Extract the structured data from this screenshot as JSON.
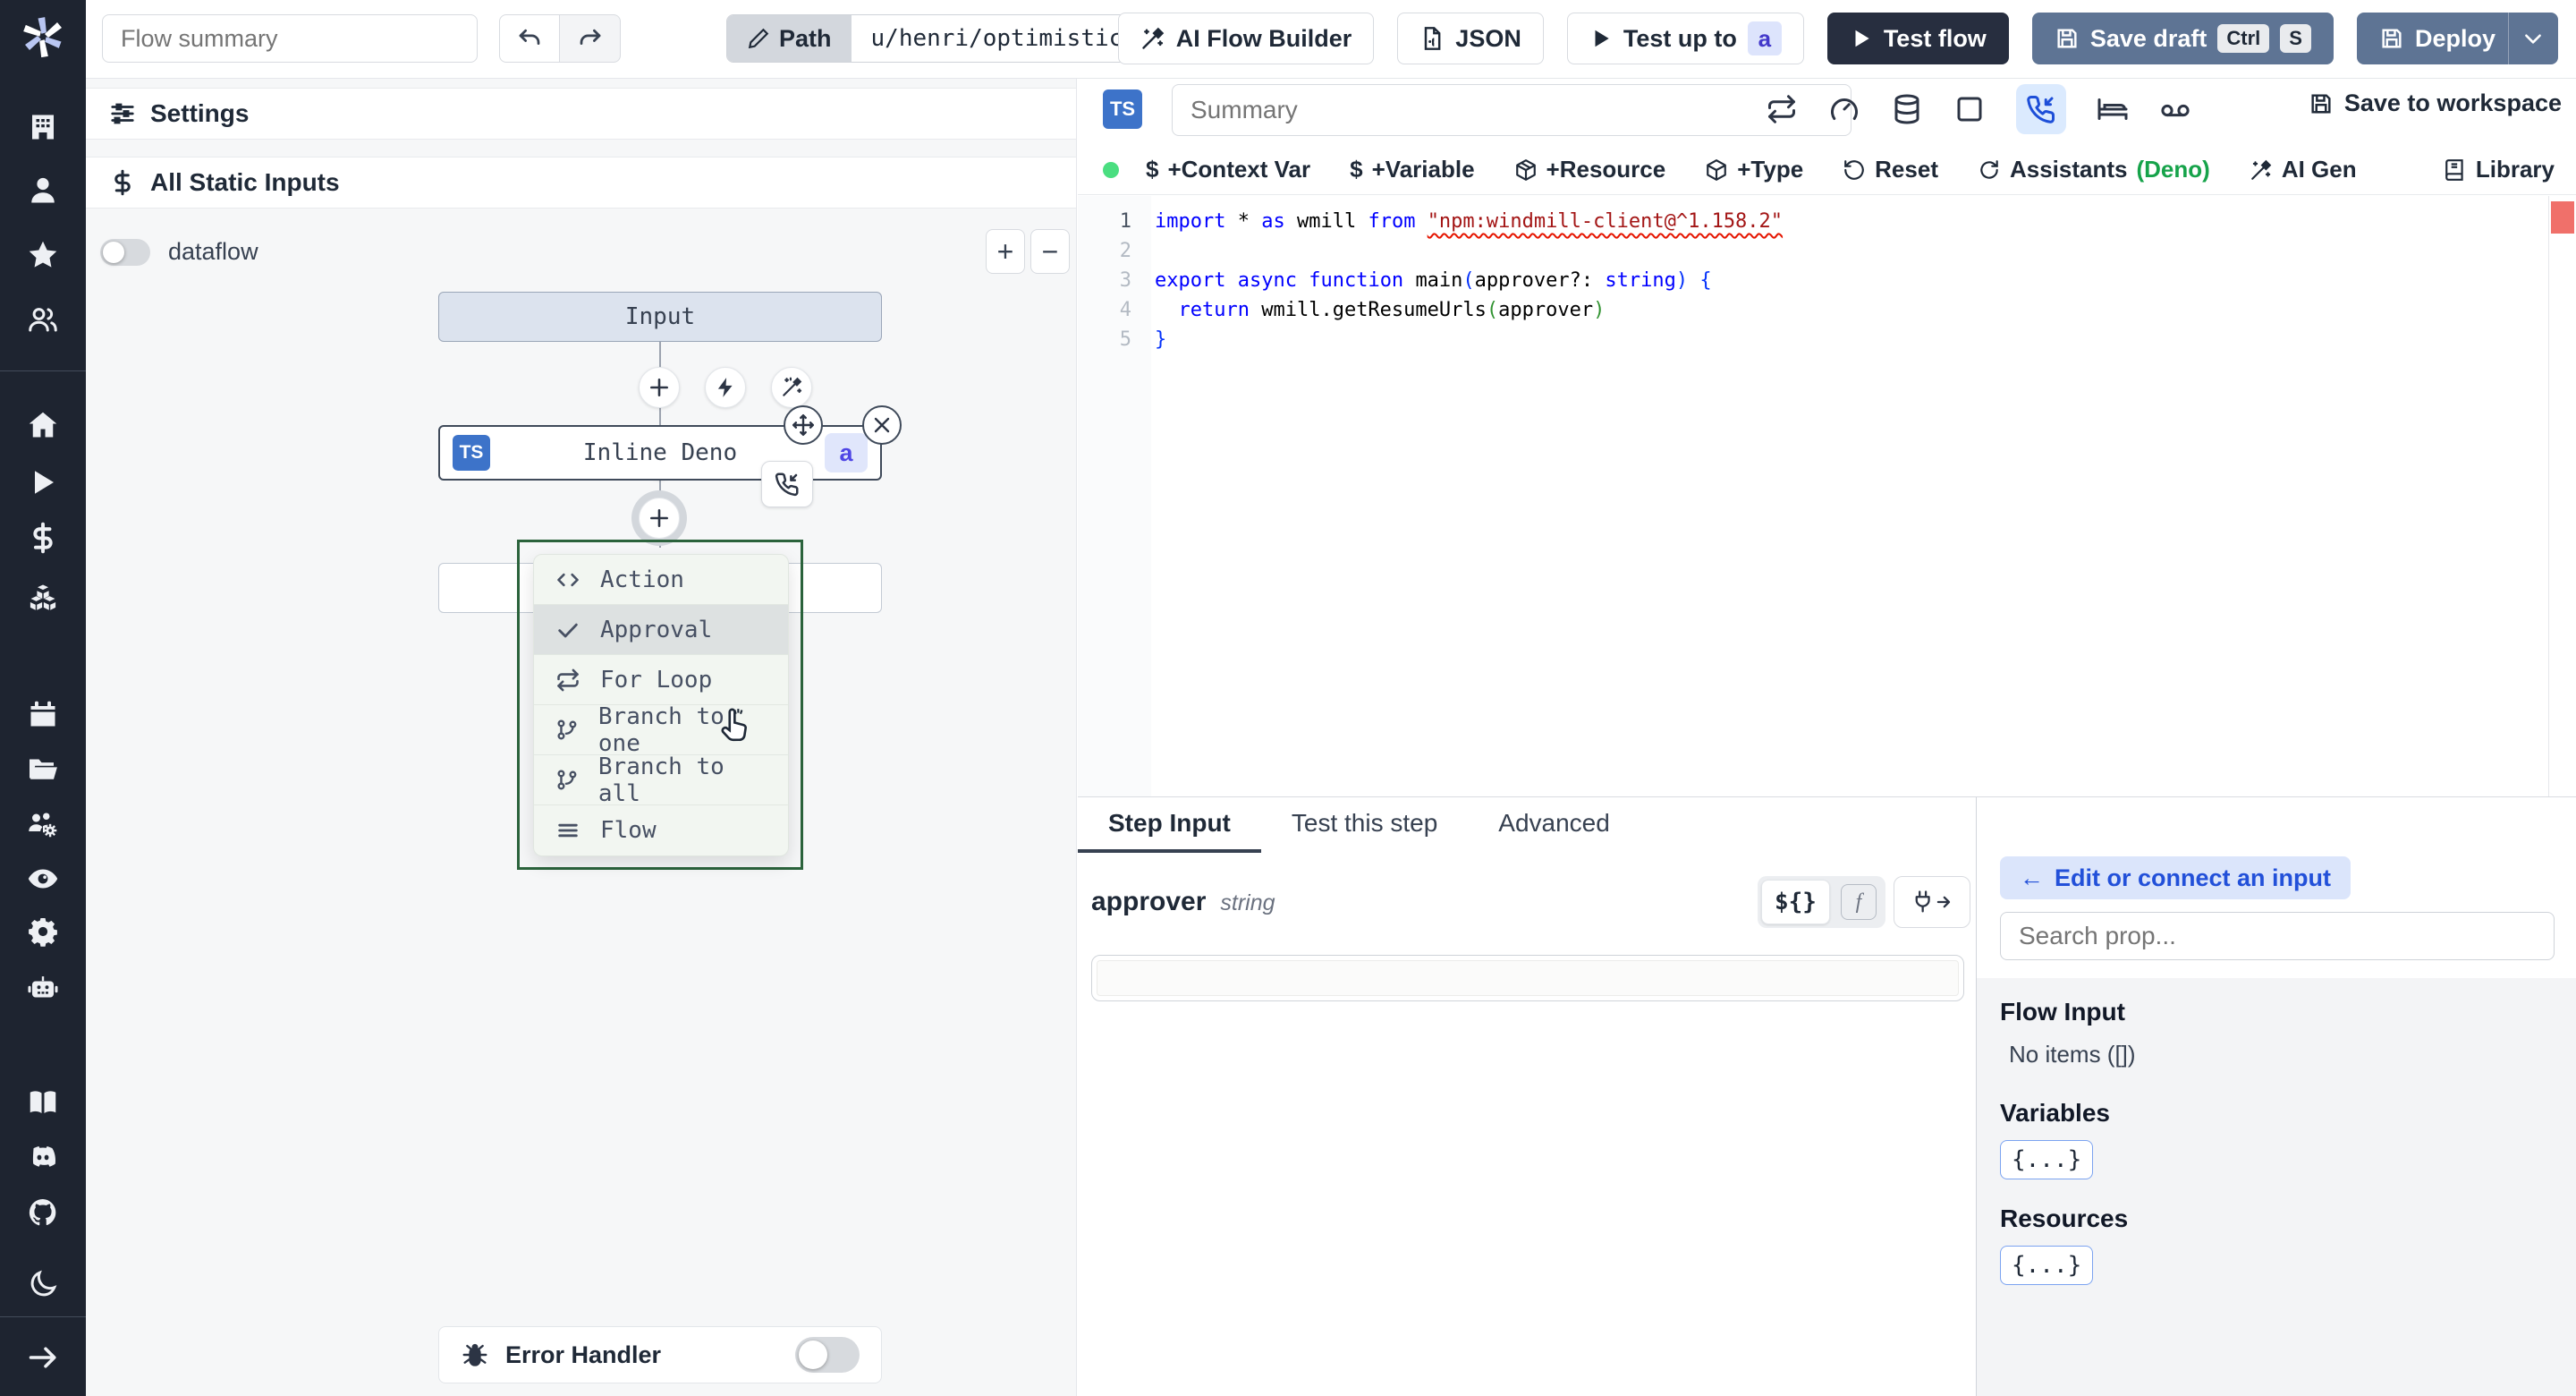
{
  "colors": {
    "accent_blue": "#2563eb",
    "sidebar_bg": "#1e2430",
    "button_slate": "#5e7494",
    "button_dark": "#272e3f",
    "menu_green_border": "#2b633c",
    "status_green": "#4ade80",
    "error_red": "#f0706a"
  },
  "sidebar": {
    "icons": [
      "building",
      "user",
      "star",
      "users-group",
      "home",
      "play",
      "dollar",
      "cubes",
      "calendar",
      "folder-open",
      "users-gear",
      "eye",
      "gear",
      "robot",
      "book",
      "discord",
      "github",
      "moon",
      "arrow-right"
    ]
  },
  "header": {
    "flow_summary_placeholder": "Flow summary",
    "path_label": "Path",
    "path_value": "u/henri/optimistic_flow",
    "ai_flow_builder": "AI Flow Builder",
    "json_label": "JSON",
    "test_up_to": "Test up to",
    "test_up_to_badge": "a",
    "test_flow": "Test flow",
    "save_draft": "Save draft",
    "kbd_ctrl": "Ctrl",
    "kbd_s": "S",
    "deploy": "Deploy"
  },
  "flow_panel": {
    "settings": "Settings",
    "all_static_inputs": "All Static Inputs",
    "dataflow": "dataflow",
    "zoom_in": "+",
    "zoom_out": "−",
    "input_node": "Input",
    "step_node": {
      "ts_badge": "TS",
      "label": "Inline Deno",
      "badge": "a"
    },
    "menu": {
      "items": [
        {
          "label": "Action"
        },
        {
          "label": "Approval"
        },
        {
          "label": "For Loop"
        },
        {
          "label": "Branch to one"
        },
        {
          "label": "Branch to all"
        },
        {
          "label": "Flow"
        }
      ]
    },
    "error_handler": "Error Handler"
  },
  "editor": {
    "ts_badge": "TS",
    "summary_placeholder": "Summary",
    "save_to_workspace": "Save to workspace",
    "toolbar": {
      "dollar": "$",
      "context_var": "+Context Var",
      "variable": "+Variable",
      "resource": "+Resource",
      "type": "+Type",
      "reset": "Reset",
      "assistants": "Assistants",
      "assistants_lang": "(Deno)",
      "ai_gen": "AI Gen",
      "library": "Library"
    },
    "code": {
      "numbers": [
        "1",
        "2",
        "3",
        "4",
        "5"
      ],
      "l1": {
        "t0": "import",
        "t1": " * ",
        "t2": "as",
        "t3": " wmill ",
        "t4": "from",
        "t5": " ",
        "t6": "\"npm:windmill-client@^1.158.2\""
      },
      "l3": {
        "t0": "export",
        "t1": " ",
        "t2": "async",
        "t3": " ",
        "t4": "function",
        "t5": " ",
        "t6": "main",
        "t7": "(",
        "t8": "approver?: ",
        "t9": "string",
        "t10": ") {"
      },
      "l4": {
        "t0": "  ",
        "t1": "return",
        "t2": " wmill.getResumeUrls",
        "t3": "(",
        "t4": "approver",
        "t5": ")"
      },
      "l5": {
        "t0": "}"
      }
    }
  },
  "step_panel": {
    "tabs": [
      {
        "label": "Step Input"
      },
      {
        "label": "Test this step"
      },
      {
        "label": "Advanced"
      }
    ],
    "prop_name": "approver",
    "prop_type": "string",
    "expr_toggle": "${}",
    "fn_toggle": "f",
    "field_value": ""
  },
  "connect_panel": {
    "back_arrow": "←",
    "edit_or_connect": "Edit or connect an input",
    "search_placeholder": "Search prop...",
    "flow_input": "Flow Input",
    "no_items": "No items ([])",
    "variables": "Variables",
    "resources": "Resources",
    "braces_chip": "{...}"
  }
}
